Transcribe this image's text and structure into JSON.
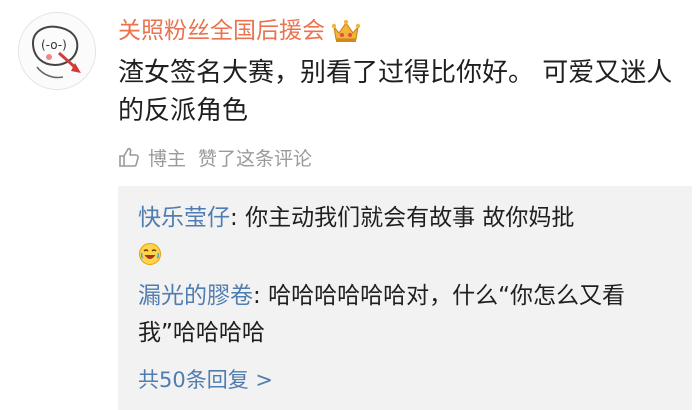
{
  "comment": {
    "username": "关照粉丝全国后援会",
    "badge_icon": "crown-icon",
    "text": "渣女签名大赛，别看了过得比你好。 可爱又迷人的反派角色",
    "liked_by_author": {
      "role": "博主",
      "text": "赞了这条评论"
    }
  },
  "replies": [
    {
      "name": "快乐莹仔",
      "separator": ": ",
      "text": "你主动我们就会有故事 故你妈批",
      "emoji": "laughing-face-icon"
    },
    {
      "name": "漏光的膠卷",
      "separator": ": ",
      "text": "哈哈哈哈哈哈对，什么“你怎么又看我”哈哈哈哈"
    }
  ],
  "more_replies": "共50条回复 >",
  "colors": {
    "username": "#eb7350",
    "link": "#507daf",
    "muted": "#9a9a9a",
    "reply_bg": "#f2f2f2"
  }
}
